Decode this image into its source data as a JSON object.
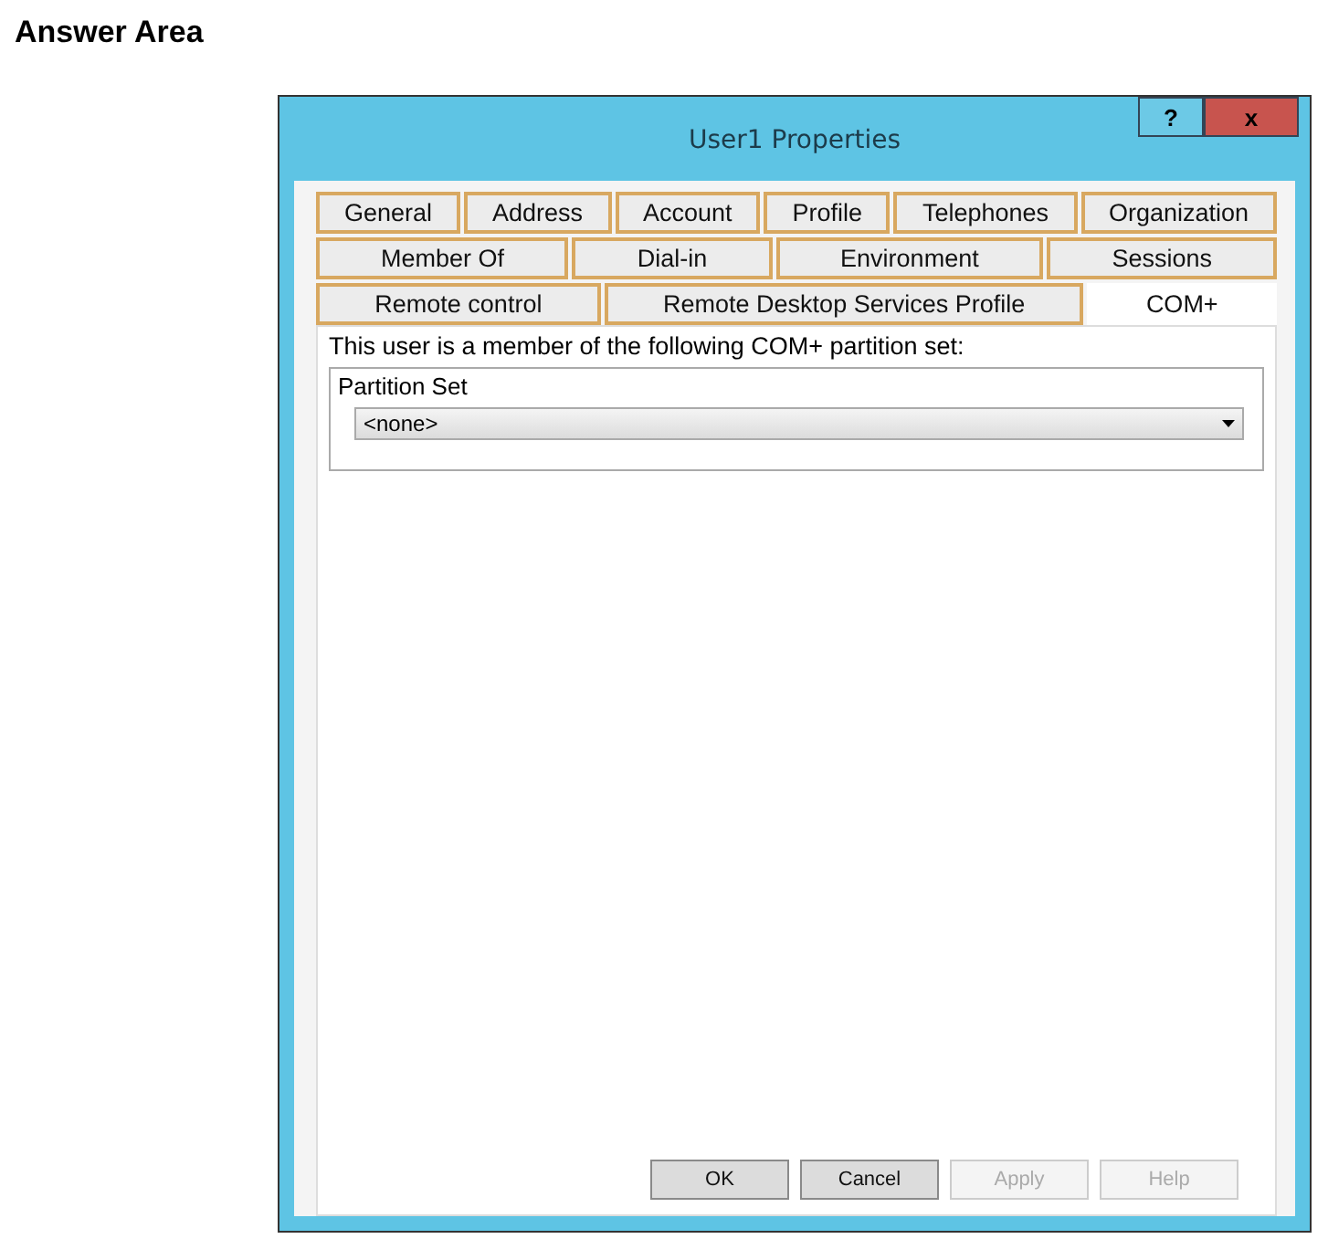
{
  "heading": "Answer Area",
  "window": {
    "title": "User1 Properties",
    "help_button": "?",
    "close_button": "x"
  },
  "tab_rows": [
    [
      {
        "label": "General",
        "selected": false
      },
      {
        "label": "Address",
        "selected": false
      },
      {
        "label": "Account",
        "selected": false
      },
      {
        "label": "Profile",
        "selected": false
      },
      {
        "label": "Telephones",
        "selected": false
      },
      {
        "label": "Organization",
        "selected": false
      }
    ],
    [
      {
        "label": "Member Of",
        "selected": false
      },
      {
        "label": "Dial-in",
        "selected": false
      },
      {
        "label": "Environment",
        "selected": false
      },
      {
        "label": "Sessions",
        "selected": false
      }
    ],
    [
      {
        "label": "Remote control",
        "selected": false
      },
      {
        "label": "Remote Desktop Services Profile",
        "selected": false
      },
      {
        "label": "COM+",
        "selected": true
      }
    ]
  ],
  "description": "This user is a member of the following COM+ partition set:",
  "partition_set": {
    "label": "Partition Set",
    "value": "<none>"
  },
  "buttons": [
    {
      "label": "OK",
      "disabled": false
    },
    {
      "label": "Cancel",
      "disabled": false
    },
    {
      "label": "Apply",
      "disabled": true
    },
    {
      "label": "Help",
      "disabled": true
    }
  ]
}
